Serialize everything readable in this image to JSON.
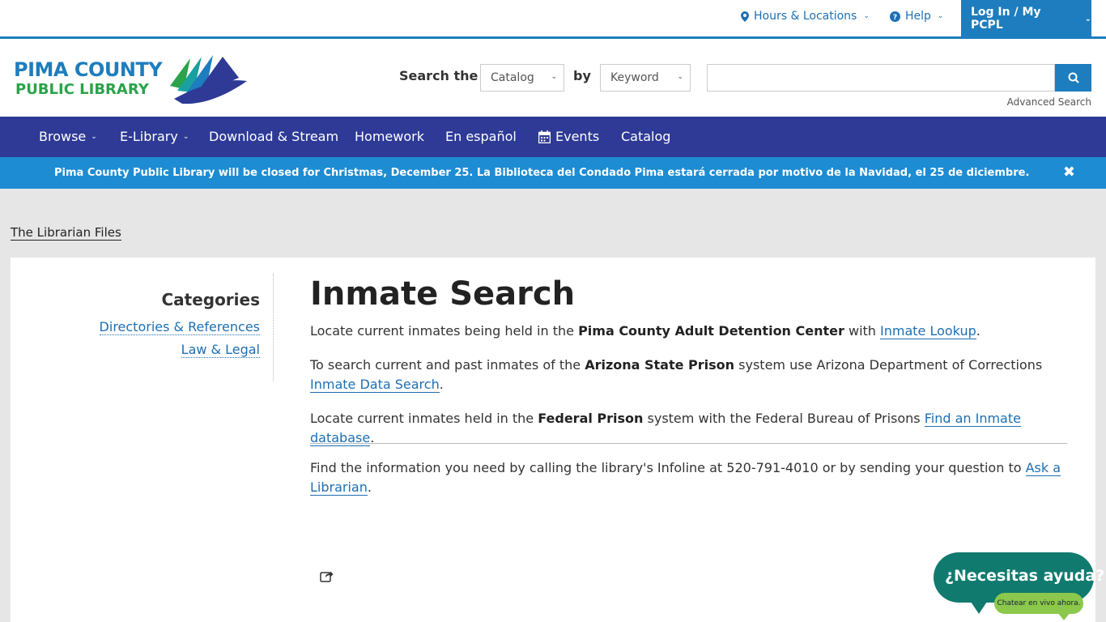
{
  "utility": {
    "hours_label": "Hours & Locations",
    "help_label": "Help",
    "login_label": "Log In / My PCPL"
  },
  "header": {
    "logo_line1": "PIMA COUNTY",
    "logo_line2": "PUBLIC LIBRARY",
    "search_label": "Search the",
    "by_label": "by",
    "scope_select": "Catalog",
    "type_select": "Keyword",
    "search_value": "",
    "advanced_label": "Advanced Search"
  },
  "nav": {
    "items": [
      "Browse",
      "E-Library",
      "Download & Stream",
      "Homework",
      "En español",
      "Events",
      "Catalog"
    ]
  },
  "alert": {
    "text": "Pima County Public Library will be closed for Christmas, December 25. La Biblioteca del Condado Pima estará cerrada por motivo de la Navidad, el 25 de diciembre."
  },
  "breadcrumb": "The Librarian Files",
  "sidebar": {
    "title": "Categories",
    "links": [
      "Directories & References",
      "Law & Legal"
    ]
  },
  "main": {
    "title": "Inmate Search",
    "p1": {
      "pre": "Locate current inmates being held in the ",
      "bold": "Pima County Adult Detention Center",
      "mid": " with ",
      "link": "Inmate Lookup",
      "post": "."
    },
    "p2": {
      "pre": "To search current and past inmates of the ",
      "bold": "Arizona State Prison",
      "mid": " system use Arizona Department of Corrections ",
      "link": "Inmate Data Search",
      "post": "."
    },
    "p3": {
      "pre": "Locate current inmates held in the ",
      "bold": "Federal Prison",
      "mid": " system with the Federal Bureau of Prisons ",
      "link": "Find an Inmate database",
      "post": "."
    },
    "p4": {
      "pre": "Find the information you need by calling the library's Infoline at 520-791-4010 or by sending your question to ",
      "link": "Ask a Librarian",
      "post": "."
    }
  },
  "chat": {
    "title": "¿Necesitas ayuda?",
    "subtitle": "Chatear en vivo ahora."
  },
  "colors": {
    "accent_blue": "#1d7dbe",
    "nav_bg": "#2e3a96",
    "alert_bg": "#1d8cd3",
    "chat_green": "#117a6f",
    "chat_light": "#8cc84b"
  },
  "icons": [
    "map-marker-icon",
    "question-circle-icon",
    "chevron-down-icon",
    "search-icon",
    "calendar-icon",
    "close-icon",
    "share-icon"
  ]
}
